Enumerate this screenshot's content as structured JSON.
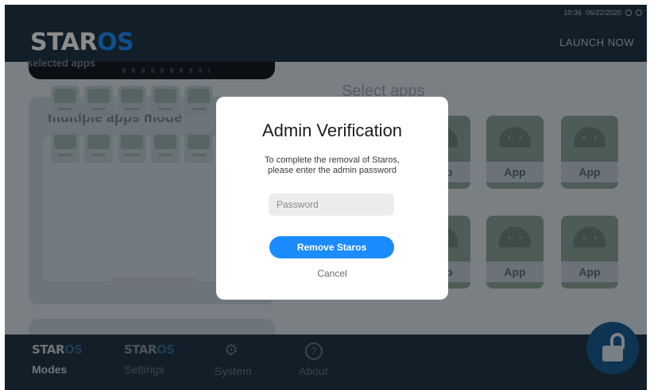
{
  "app": {
    "logo_prefix": "STAR",
    "logo_suffix": "OS"
  },
  "status_bar": {
    "time": "10:36",
    "date": "06/22/2020"
  },
  "header": {
    "launch_label": "LAUNCH NOW"
  },
  "modes_panel": {
    "mode_title": "multiple apps mode",
    "selected_apps_title": "selected apps",
    "mini_app_count": 10
  },
  "select_apps": {
    "title": "Select apps",
    "tiles": [
      {
        "label": "App"
      },
      {
        "label": "App"
      },
      {
        "label": "App"
      },
      {
        "label": "App"
      },
      {
        "label": "App"
      },
      {
        "label": "App"
      }
    ]
  },
  "bottom_nav": {
    "items": [
      {
        "logo_prefix": "STAR",
        "logo_suffix": "OS",
        "label": "Modes",
        "icon": "staros-logo"
      },
      {
        "logo_prefix": "STAR",
        "logo_suffix": "OS",
        "label": "Settings",
        "icon": "staros-logo"
      },
      {
        "label": "System",
        "icon": "gear-icon"
      },
      {
        "label": "About",
        "icon": "help-icon",
        "glyph": "?"
      }
    ]
  },
  "modal": {
    "title": "Admin Verification",
    "message_line1": "To complete the removal of Staros,",
    "message_line2": "please enter the admin password",
    "password_placeholder": "Password",
    "password_value": "",
    "primary_label": "Remove Staros",
    "cancel_label": "Cancel"
  },
  "colors": {
    "accent": "#1a8cff",
    "topbar": "#22394a",
    "lock_button": "#1b5f98"
  }
}
